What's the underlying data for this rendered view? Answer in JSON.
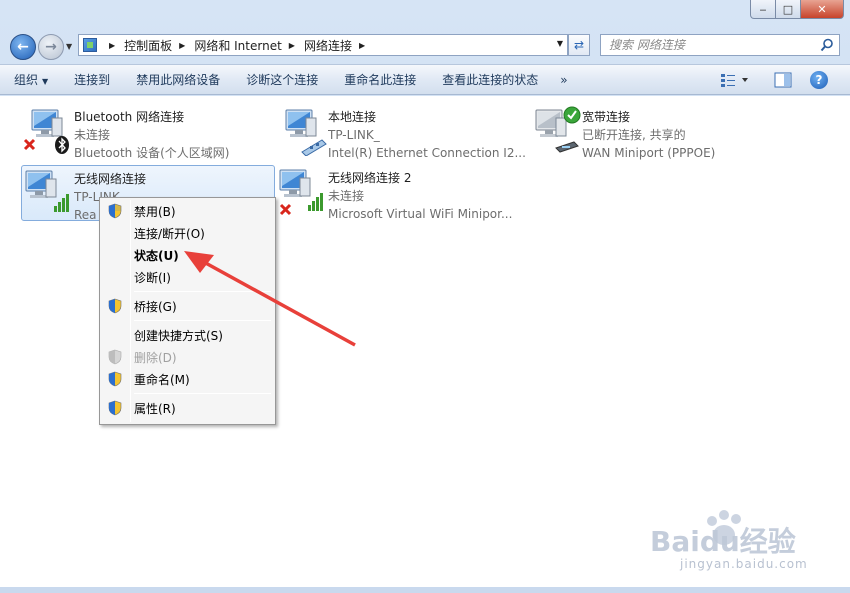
{
  "window": {
    "min_glyph": "‒",
    "max_glyph": "□",
    "close_glyph": "✕"
  },
  "address": {
    "crumbs": [
      "控制面板",
      "网络和 Internet",
      "网络连接"
    ]
  },
  "search": {
    "placeholder": "搜索 网络连接"
  },
  "toolbar": {
    "organize": "组织",
    "connect_to": "连接到",
    "disable_device": "禁用此网络设备",
    "diagnose": "诊断这个连接",
    "rename": "重命名此连接",
    "view_status": "查看此连接的状态",
    "more": "»",
    "help": "?"
  },
  "connections": [
    {
      "name": "Bluetooth 网络连接",
      "status": "未连接",
      "device": "Bluetooth 设备(个人区域网)",
      "icon": "bluetooth-network-icon",
      "overlay": "red-x"
    },
    {
      "name": "本地连接",
      "status": "TP-LINK_",
      "device": "Intel(R) Ethernet Connection I2...",
      "icon": "ethernet-network-icon",
      "overlay": "none"
    },
    {
      "name": "宽带连接",
      "status": "已断开连接, 共享的",
      "device": "WAN Miniport (PPPOE)",
      "icon": "broadband-network-icon",
      "overlay": "green-check"
    },
    {
      "name": "无线网络连接",
      "status": "TP-LINK",
      "device": "Rea",
      "icon": "wireless-network-icon",
      "overlay": "signal"
    },
    {
      "name": "无线网络连接 2",
      "status": "未连接",
      "device": "Microsoft Virtual WiFi Minipor...",
      "icon": "wireless-network-icon",
      "overlay": "red-x"
    }
  ],
  "context_menu": [
    {
      "label": "禁用(B)",
      "shield": true,
      "bold": false,
      "disabled": false
    },
    {
      "label": "连接/断开(O)",
      "shield": false,
      "bold": false,
      "disabled": false
    },
    {
      "label": "状态(U)",
      "shield": false,
      "bold": true,
      "disabled": false
    },
    {
      "label": "诊断(I)",
      "shield": false,
      "bold": false,
      "disabled": false
    },
    {
      "label": "桥接(G)",
      "shield": true,
      "bold": false,
      "disabled": false
    },
    {
      "label": "创建快捷方式(S)",
      "shield": false,
      "bold": false,
      "disabled": false
    },
    {
      "label": "删除(D)",
      "shield": true,
      "bold": false,
      "disabled": true
    },
    {
      "label": "重命名(M)",
      "shield": true,
      "bold": false,
      "disabled": false
    },
    {
      "label": "属性(R)",
      "shield": true,
      "bold": false,
      "disabled": false
    }
  ],
  "watermark": {
    "logo": "Baidu经验",
    "url": "jingyan.baidu.com"
  },
  "colors": {
    "accent_arrow": "#e8403a",
    "selection": "#d9e9fa",
    "menu_bg": "#f5f5f5"
  }
}
